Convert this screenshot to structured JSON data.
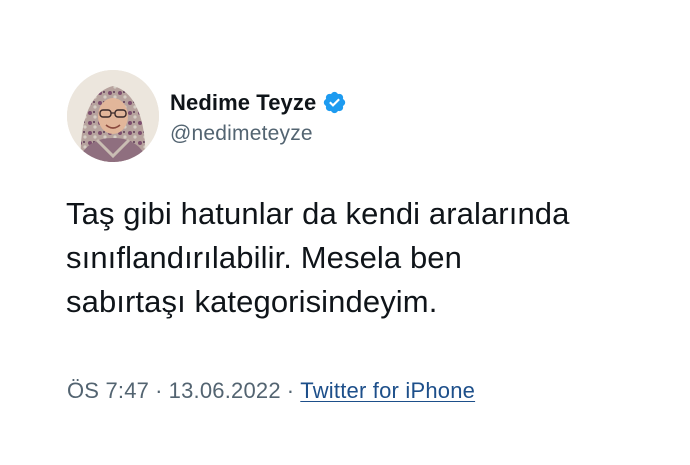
{
  "author": {
    "display_name": "Nedime Teyze",
    "handle": "@nedimeteyze",
    "avatar_icon": "profile-photo",
    "verified_icon": "verified-badge-icon",
    "verified_color": "#1d9bf0"
  },
  "tweet": {
    "text": "Taş gibi hatunlar da kendi aralarında\nsınıflandırılabilir. Mesela ben\nsabırtaşı kategorisindeyim."
  },
  "meta": {
    "time": "ÖS 7:47",
    "separator": "·",
    "date": "13.06.2022",
    "source": "Twitter for iPhone"
  },
  "colors": {
    "text_primary": "#0f1419",
    "text_secondary": "#536471",
    "link": "#1d4f8a",
    "background": "#ffffff"
  }
}
